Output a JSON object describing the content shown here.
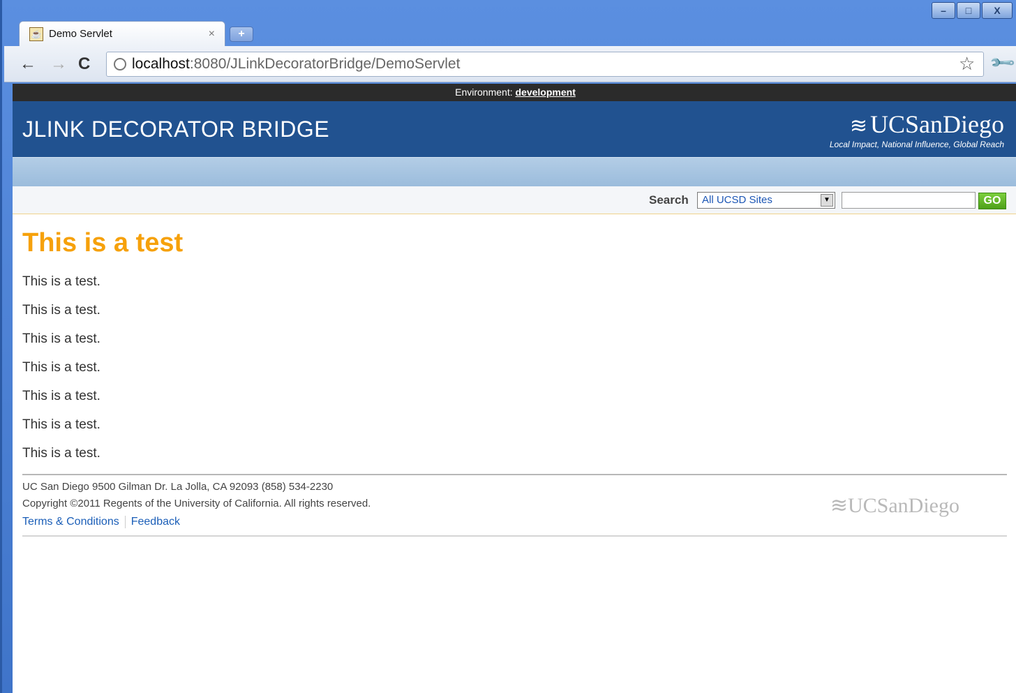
{
  "browser": {
    "tab_title": "Demo Servlet",
    "tab_close": "×",
    "new_tab": "+",
    "url_host": "localhost",
    "url_rest": ":8080/JLinkDecoratorBridge/DemoServlet",
    "window_minimize": "–",
    "window_maximize": "□",
    "window_close": "X"
  },
  "env": {
    "label": "Environment: ",
    "value": "development"
  },
  "header": {
    "title": "JLINK DECORATOR BRIDGE",
    "logo_text": "UCSanDiego",
    "logo_tagline": "Local Impact, National Influence, Global Reach"
  },
  "search": {
    "label": "Search",
    "scope": "All UCSD Sites",
    "go": "GO"
  },
  "main": {
    "heading": "This is a test",
    "paragraphs": [
      "This is a test.",
      "This is a test.",
      "This is a test.",
      "This is a test.",
      "This is a test.",
      "This is a test.",
      "This is a test."
    ]
  },
  "footer": {
    "address": "UC San Diego 9500 Gilman Dr. La Jolla, CA 92093 (858) 534-2230",
    "copyright": "Copyright ©2011 Regents of the University of California. All rights reserved.",
    "terms": "Terms & Conditions",
    "feedback": "Feedback",
    "logo_text": "UCSanDiego"
  },
  "colors": {
    "header_bg": "#215290",
    "heading": "#f6a10a",
    "link": "#1c5fb8",
    "go_button": "#4ea01a"
  },
  "icons": [
    "back-arrow-icon",
    "forward-arrow-icon",
    "reload-icon",
    "globe-icon",
    "star-icon",
    "wrench-icon",
    "tab-favicon"
  ]
}
